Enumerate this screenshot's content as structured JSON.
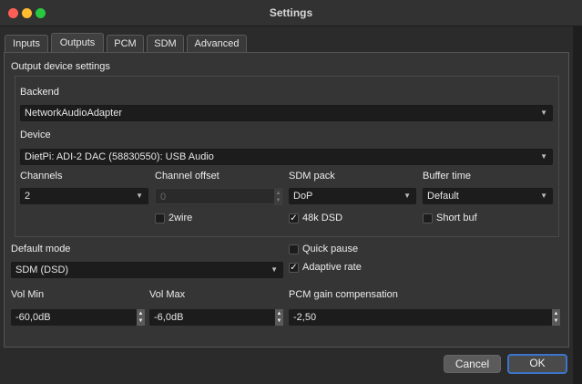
{
  "window": {
    "title": "Settings"
  },
  "tabs": [
    {
      "label": "Inputs",
      "active": false
    },
    {
      "label": "Outputs",
      "active": true
    },
    {
      "label": "PCM",
      "active": false
    },
    {
      "label": "SDM",
      "active": false
    },
    {
      "label": "Advanced",
      "active": false
    }
  ],
  "output_device": {
    "section_label": "Output device settings",
    "backend_label": "Backend",
    "backend_value": "NetworkAudioAdapter",
    "device_label": "Device",
    "device_value": "DietPi: ADI-2 DAC (58830550): USB Audio",
    "channels_label": "Channels",
    "channels_value": "2",
    "channel_offset_label": "Channel offset",
    "channel_offset_value": "0",
    "sdm_pack_label": "SDM pack",
    "sdm_pack_value": "DoP",
    "buffer_time_label": "Buffer time",
    "buffer_time_value": "Default",
    "twowire_label": "2wire",
    "twowire_checked": false,
    "dsd48k_label": "48k DSD",
    "dsd48k_checked": true,
    "shortbuf_label": "Short buf",
    "shortbuf_checked": false
  },
  "general": {
    "default_mode_label": "Default mode",
    "default_mode_value": "SDM (DSD)",
    "quick_pause_label": "Quick pause",
    "quick_pause_checked": false,
    "adaptive_rate_label": "Adaptive rate",
    "adaptive_rate_checked": true,
    "vol_min_label": "Vol Min",
    "vol_min_value": "-60,0dB",
    "vol_max_label": "Vol Max",
    "vol_max_value": "-6,0dB",
    "pcm_gain_label": "PCM gain compensation",
    "pcm_gain_value": "-2,50"
  },
  "buttons": {
    "cancel_label": "Cancel",
    "ok_label": "OK"
  },
  "check_glyph": "✓",
  "colors": {
    "close": "#ff5f57",
    "minimize": "#febc2e",
    "zoom": "#28c840",
    "ok_border": "#3b75c9"
  }
}
